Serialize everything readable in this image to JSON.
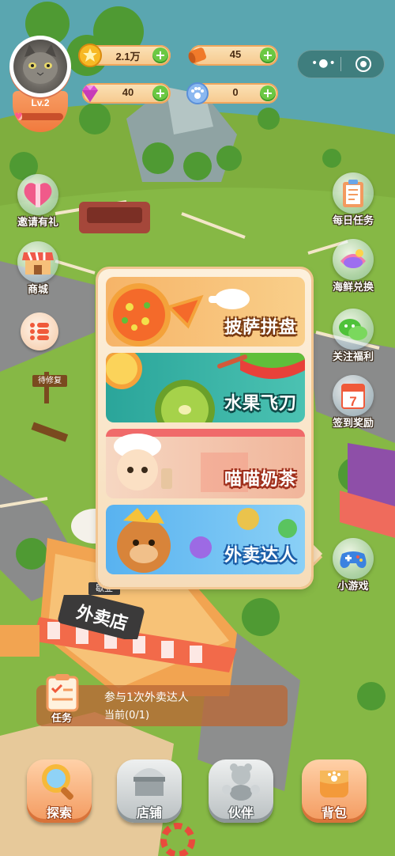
{
  "player": {
    "level": "Lv.2",
    "xp_progress": 0.05
  },
  "resources": {
    "gold": "2.1万",
    "scroll": "45",
    "gem": "40",
    "paw_coin": "0"
  },
  "side_left": [
    {
      "label": "邀请有礼",
      "icon": "gift-heart-icon"
    },
    {
      "label": "商城",
      "icon": "shop-icon"
    }
  ],
  "side_right": [
    {
      "label": "每日任务",
      "icon": "clipboard-icon"
    },
    {
      "label": "海鲜兑换",
      "icon": "seafood-icon"
    },
    {
      "label": "关注福利",
      "icon": "wechat-icon"
    },
    {
      "label": "签到奖励",
      "icon": "calendar-icon"
    },
    {
      "label": "小游戏",
      "icon": "gamepad-icon"
    }
  ],
  "calendar_day": "7",
  "games": [
    {
      "title": "披萨拼盘"
    },
    {
      "title": "水果飞刀"
    },
    {
      "title": "喵喵奶茶"
    },
    {
      "title": "外卖达人"
    }
  ],
  "scene_signs": {
    "repair": "待修复",
    "closed": "歇业",
    "delivery_shop": "外卖店"
  },
  "task": {
    "label": "任务",
    "line1": "参与1次外卖达人",
    "line2": "当前(0/1)"
  },
  "nav": [
    {
      "label": "探索",
      "icon": "magnifier-icon"
    },
    {
      "label": "店铺",
      "icon": "store-icon"
    },
    {
      "label": "伙伴",
      "icon": "partner-icon"
    },
    {
      "label": "背包",
      "icon": "backpack-icon"
    }
  ],
  "colors": {
    "accent": "#f39a5f",
    "plus_green": "#6bc843",
    "task_bg": "#ba6836"
  }
}
